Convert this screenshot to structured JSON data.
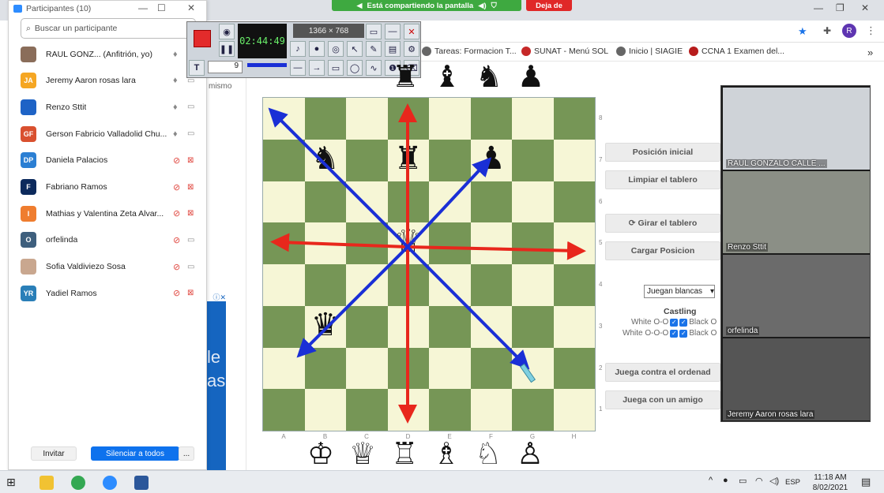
{
  "browser": {
    "share_banner": "Está compartiendo la pantalla",
    "stop_share": "Deja de",
    "bookmarks": [
      "Tareas: Formacion T...",
      "SUNAT - Menú SOL",
      "Inicio | SIAGIE",
      "CCNA 1 Examen del..."
    ],
    "profile_initial": "R"
  },
  "participants_panel": {
    "title": "Participantes (10)",
    "search_placeholder": "Buscar un participante",
    "participants": [
      {
        "name": "RAUL GONZ... (Anfitrión, yo)",
        "initials": "",
        "color": "#8a6d5a",
        "mic_muted": false,
        "cam_off": false
      },
      {
        "name": "Jeremy Aaron rosas lara",
        "initials": "JA",
        "color": "#f5a623",
        "mic_muted": false,
        "cam_off": false
      },
      {
        "name": "Renzo Sttit",
        "initials": "",
        "color": "#1e63c6",
        "mic_muted": false,
        "cam_off": false
      },
      {
        "name": "Gerson Fabricio Valladolid Chu...",
        "initials": "GF",
        "color": "#d9502f",
        "mic_muted": false,
        "cam_off": false
      },
      {
        "name": "Daniela Palacios",
        "initials": "DP",
        "color": "#2b7fd3",
        "mic_muted": true,
        "cam_off": true
      },
      {
        "name": "Fabriano Ramos",
        "initials": "F",
        "color": "#0c2a5c",
        "mic_muted": true,
        "cam_off": true
      },
      {
        "name": "Mathias y Valentina Zeta Alvar...",
        "initials": "I",
        "color": "#ef7d2f",
        "mic_muted": true,
        "cam_off": true
      },
      {
        "name": "orfelinda",
        "initials": "O",
        "color": "#3e5f7d",
        "mic_muted": true,
        "cam_off": false
      },
      {
        "name": "Sofia Valdiviezo Sosa",
        "initials": "",
        "color": "#c9a78f",
        "mic_muted": true,
        "cam_off": false
      },
      {
        "name": "Yadiel Ramos",
        "initials": "YR",
        "color": "#2a7fb8",
        "mic_muted": true,
        "cam_off": true
      }
    ],
    "invite_label": "Invitar",
    "mute_all_label": "Silenciar a todos",
    "more_label": "..."
  },
  "recorder": {
    "timer": "02:44:49",
    "resolution": "1366 × 768",
    "pen_size": "9"
  },
  "page": {
    "left_strip_text": "mismo",
    "side_buttons": [
      "Posición inicial",
      "Limpiar el tablero",
      "Girar el tablero",
      "Cargar Posicion",
      "Juega contra el ordenad",
      "Juega con un amigo"
    ],
    "turn_select": "Juegan blancas",
    "castling_title": "Castling",
    "castling_white_short": "White O-O",
    "castling_white_long": "White O-O-O",
    "castling_black_short": "Black O",
    "castling_black_long": "Black O",
    "files": [
      "A",
      "B",
      "C",
      "D",
      "E",
      "F",
      "G",
      "H"
    ],
    "ranks": [
      "8",
      "7",
      "6",
      "5",
      "4",
      "3",
      "2",
      "1"
    ],
    "pieces": [
      {
        "glyph": "♞",
        "file": 1,
        "rank": 7
      },
      {
        "glyph": "♜",
        "file": 3,
        "rank": 7
      },
      {
        "glyph": "♟",
        "file": 5,
        "rank": 7
      },
      {
        "glyph": "♕",
        "file": 3,
        "rank": 5
      },
      {
        "glyph": "♛",
        "file": 1,
        "rank": 3
      }
    ],
    "top_tray": [
      "♜",
      "♝",
      "♞",
      "♟"
    ],
    "bottom_tray": [
      "♔",
      "♕",
      "♖",
      "♗",
      "♘",
      "♙"
    ]
  },
  "videos": [
    {
      "label": "RAUL GONZALO CALLE ...",
      "bg": "#cfd3d8"
    },
    {
      "label": "Renzo Sttit",
      "bg": "#8b8f86"
    },
    {
      "label": "orfelinda",
      "bg": "#6b6b6b"
    },
    {
      "label": "Jeremy Aaron rosas lara",
      "bg": "#555"
    }
  ],
  "taskbar": {
    "time": "11:18 AM",
    "date": "8/02/2021",
    "lang": "ESP"
  },
  "colors": {
    "accent": "#0e72ed",
    "board_light": "#f6f6d6",
    "board_dark": "#769656",
    "arrow_red": "#e8271c",
    "arrow_blue": "#1a2fd6"
  }
}
